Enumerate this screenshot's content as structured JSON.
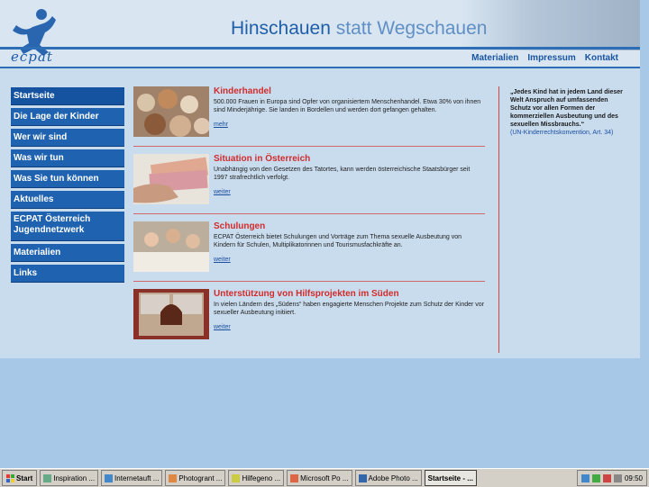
{
  "site": {
    "title_part1": "Hinschauen",
    "title_part2": "statt Wegschauen",
    "logo_text": "ecpat"
  },
  "topnav": [
    "Materialien",
    "Impressum",
    "Kontakt"
  ],
  "sidebar": {
    "items": [
      {
        "label": "Startseite"
      },
      {
        "label": "Die Lage der Kinder"
      },
      {
        "label": "Wer wir sind"
      },
      {
        "label": "Was wir tun"
      },
      {
        "label": "Was Sie tun können"
      },
      {
        "label": "Aktuelles"
      },
      {
        "label": "ECPAT Österreich Jugendnetzwerk"
      },
      {
        "label": "Materialien"
      },
      {
        "label": "Links"
      }
    ]
  },
  "articles": [
    {
      "title": "Kinderhandel",
      "body": "500.000 Frauen in Europa sind Opfer von organisiertem Menschenhandel. Etwa 30% von ihnen sind Minderjährige. Sie landen in Bordellen und werden dort gefangen gehalten.",
      "link": "mehr"
    },
    {
      "title": "Situation in Österreich",
      "body": "Unabhängig von den Gesetzen des Tatortes, kann werden österreichische Staatsbürger seit 1997 strafrechtlich verfolgt.",
      "link": "weiter"
    },
    {
      "title": "Schulungen",
      "body": "ECPAT Österreich bietet Schulungen und Vorträge zum Thema sexuelle Ausbeutung von Kindern für Schulen, Multiplikatorinnen und Tourismusfachkräfte an.",
      "link": "weiter"
    },
    {
      "title": "Unterstützung von Hilfsprojekten im Süden",
      "body": "In vielen Ländern des „Südens“ haben engagierte Menschen Projekte zum Schutz der Kinder vor sexueller Ausbeutung initiiert.",
      "link": "weiter"
    }
  ],
  "quote": {
    "text": "„Jedes Kind hat in jedem Land dieser Welt Anspruch auf umfassenden Schutz vor allen Formen der kommerziellen Ausbeutung und des sexuellen Missbrauchs.“",
    "source": "(UN-Kinderrechtskonvention, Art. 34)"
  },
  "taskbar": {
    "start": "Start",
    "tasks": [
      "Inspiration ...",
      "Internetauft ...",
      "Photogrant ...",
      "Hilfegeno ...",
      "Microsoft Po ...",
      "Adobe Photo ...",
      "Startseite - ..."
    ],
    "clock": "09:50"
  },
  "colors": {
    "accent": "#2d6eb5",
    "headline_red": "#d22b2b",
    "nav_blue": "#1e62b0"
  }
}
